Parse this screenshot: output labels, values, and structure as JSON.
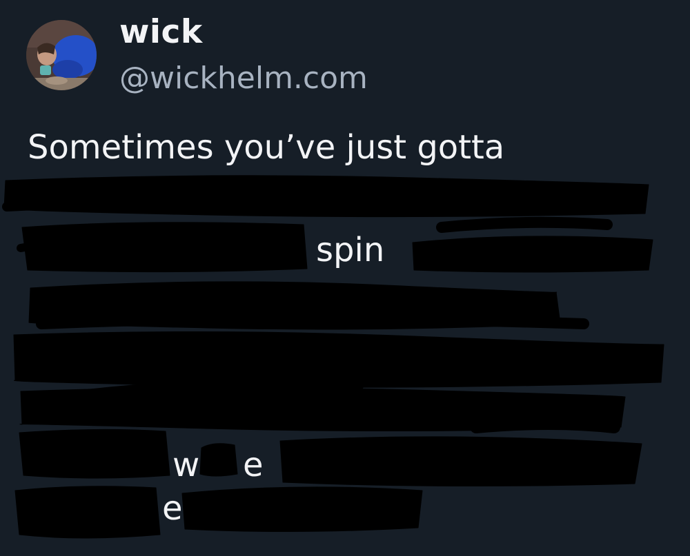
{
  "author": {
    "display_name": "wick",
    "handle": "@wickhelm.com",
    "avatar_icon": "profile-photo"
  },
  "post": {
    "line_1": "Sometimes you’ve just gotta",
    "fragment_spin": "spin",
    "fragment_w": "w",
    "fragment_e1": "e",
    "fragment_e2": "e"
  },
  "colors": {
    "background": "#161e27",
    "text": "#f3f4f6",
    "handle": "#a8b3c1",
    "redaction": "#000000"
  }
}
